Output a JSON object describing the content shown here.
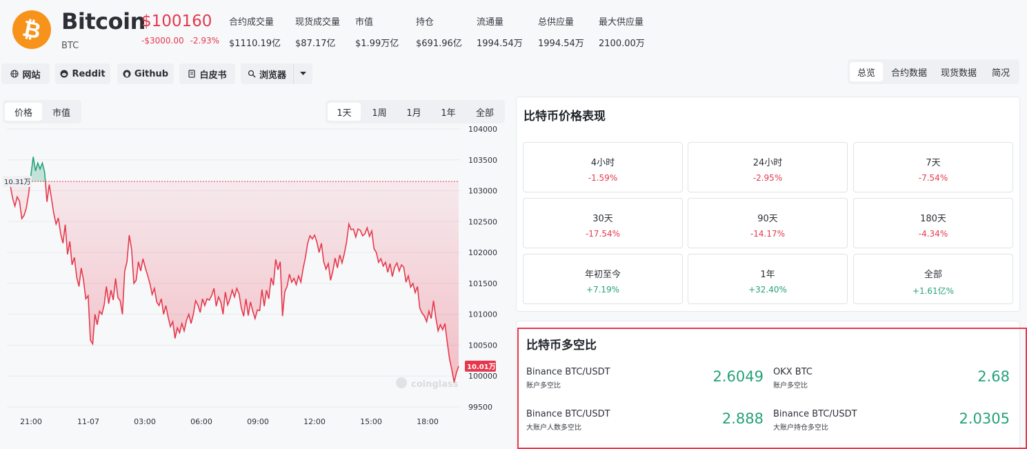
{
  "coin": {
    "name": "Bitcoin",
    "symbol": "BTC",
    "price": "$100160",
    "change_abs": "-$3000.00",
    "change_pct": "-2.93%",
    "logo_color": "#f7931a"
  },
  "stats": [
    {
      "label": "合约成交量",
      "value": "$1110.19亿"
    },
    {
      "label": "现货成交量",
      "value": "$87.17亿"
    },
    {
      "label": "市值",
      "value": "$1.99万亿"
    },
    {
      "label": "持仓",
      "value": "$691.96亿"
    },
    {
      "label": "流通量",
      "value": "1994.54万"
    },
    {
      "label": "总供应量",
      "value": "1994.54万"
    },
    {
      "label": "最大供应量",
      "value": "2100.00万"
    }
  ],
  "links": [
    {
      "label": "网站",
      "icon": "globe-icon"
    },
    {
      "label": "Reddit",
      "icon": "reddit-icon"
    },
    {
      "label": "Github",
      "icon": "github-icon"
    },
    {
      "label": "白皮书",
      "icon": "document-icon"
    },
    {
      "label": "浏览器",
      "icon": "explorer-icon"
    }
  ],
  "top_tabs": [
    "总览",
    "合约数据",
    "现货数据",
    "简况"
  ],
  "chart": {
    "modes": [
      "价格",
      "市值"
    ],
    "ranges": [
      "1天",
      "1周",
      "1月",
      "1年",
      "全部"
    ],
    "start_label": "10.31万",
    "current_label": "10.01万",
    "watermark": "coinglass",
    "y_ticks": [
      "104000",
      "103500",
      "103000",
      "102500",
      "102000",
      "101500",
      "101000",
      "100500",
      "100000",
      "99500"
    ],
    "x_ticks": [
      "21:00",
      "11-07",
      "03:00",
      "06:00",
      "09:00",
      "12:00",
      "15:00",
      "18:00"
    ],
    "colors": {
      "up": "#25a17a",
      "down": "#e5384c"
    }
  },
  "chart_data": {
    "type": "area",
    "ylim": [
      99500,
      104000
    ],
    "baseline": 103150,
    "x_ticks": [
      "21:00",
      "11-07",
      "03:00",
      "06:00",
      "09:00",
      "12:00",
      "15:00",
      "18:00"
    ],
    "y": [
      103080,
      102880,
      102750,
      102900,
      102830,
      102550,
      102600,
      102720,
      102950,
      103250,
      103550,
      103320,
      103450,
      103350,
      103450,
      103300,
      102820,
      103100,
      102870,
      102630,
      102460,
      102560,
      102300,
      102150,
      102450,
      101970,
      102180,
      101800,
      101920,
      101600,
      101450,
      101750,
      101550,
      101250,
      101300,
      100580,
      100520,
      101000,
      100830,
      101050,
      101000,
      101150,
      101450,
      101170,
      101390,
      101230,
      101580,
      101270,
      101220,
      101000,
      101700,
      101850,
      102280,
      102050,
      101500,
      101550,
      101850,
      101700,
      101900,
      101750,
      101630,
      101500,
      101320,
      101420,
      101200,
      101140,
      101250,
      101000,
      101140,
      100950,
      100800,
      100880,
      100610,
      100780,
      100700,
      100850,
      100730,
      100900,
      101000,
      100850,
      101000,
      101220,
      101150,
      101030,
      101250,
      101140,
      101250,
      101230,
      101300,
      101420,
      101130,
      101280,
      101200,
      101000,
      101360,
      101150,
      101250,
      101390,
      101280,
      101420,
      101330,
      101100,
      100970,
      101250,
      100980,
      101200,
      101050,
      100930,
      101070,
      101060,
      101400,
      101130,
      101390,
      101250,
      101590,
      101470,
      101890,
      101720,
      101850,
      100970,
      101370,
      101450,
      101650,
      101520,
      101580,
      101480,
      101620,
      101520,
      101740,
      101920,
      102150,
      102270,
      102220,
      102280,
      102170,
      102000,
      102150,
      101850,
      101730,
      101820,
      101550,
      101700,
      101910,
      101750,
      101960,
      101830,
      101980,
      102170,
      102460,
      102370,
      102380,
      102250,
      102380,
      102360,
      102270,
      102300,
      102400,
      102260,
      102350,
      102060,
      102000,
      101840,
      101900,
      101780,
      101840,
      101680,
      101820,
      101610,
      101760,
      101830,
      101700,
      101800,
      101760,
      101520,
      101620,
      101440,
      101500,
      101350,
      101450,
      101100,
      101020,
      100970,
      100880,
      101050,
      100930,
      101220,
      100950,
      100730,
      100830,
      100750,
      100850,
      100550,
      100280,
      100100,
      99900,
      100050,
      100160
    ]
  },
  "performance": {
    "title": "比特币价格表现",
    "items": [
      {
        "label": "4小时",
        "value": "-1.59%",
        "dir": "neg"
      },
      {
        "label": "24小时",
        "value": "-2.95%",
        "dir": "neg"
      },
      {
        "label": "7天",
        "value": "-7.54%",
        "dir": "neg"
      },
      {
        "label": "30天",
        "value": "-17.54%",
        "dir": "neg"
      },
      {
        "label": "90天",
        "value": "-14.17%",
        "dir": "neg"
      },
      {
        "label": "180天",
        "value": "-4.34%",
        "dir": "neg"
      },
      {
        "label": "年初至今",
        "value": "+7.19%",
        "dir": "pos"
      },
      {
        "label": "1年",
        "value": "+32.40%",
        "dir": "pos"
      },
      {
        "label": "全部",
        "value": "+1.61亿%",
        "dir": "pos"
      }
    ]
  },
  "long_short": {
    "title": "比特币多空比",
    "items": [
      {
        "label": "Binance BTC/USDT",
        "sub": "账户多空比",
        "value": "2.6049"
      },
      {
        "label": "OKX BTC",
        "sub": "账户多空比",
        "value": "2.68"
      },
      {
        "label": "Binance BTC/USDT",
        "sub": "大账户人数多空比",
        "value": "2.888"
      },
      {
        "label": "Binance BTC/USDT",
        "sub": "大账户持仓多空比",
        "value": "2.0305"
      }
    ]
  }
}
